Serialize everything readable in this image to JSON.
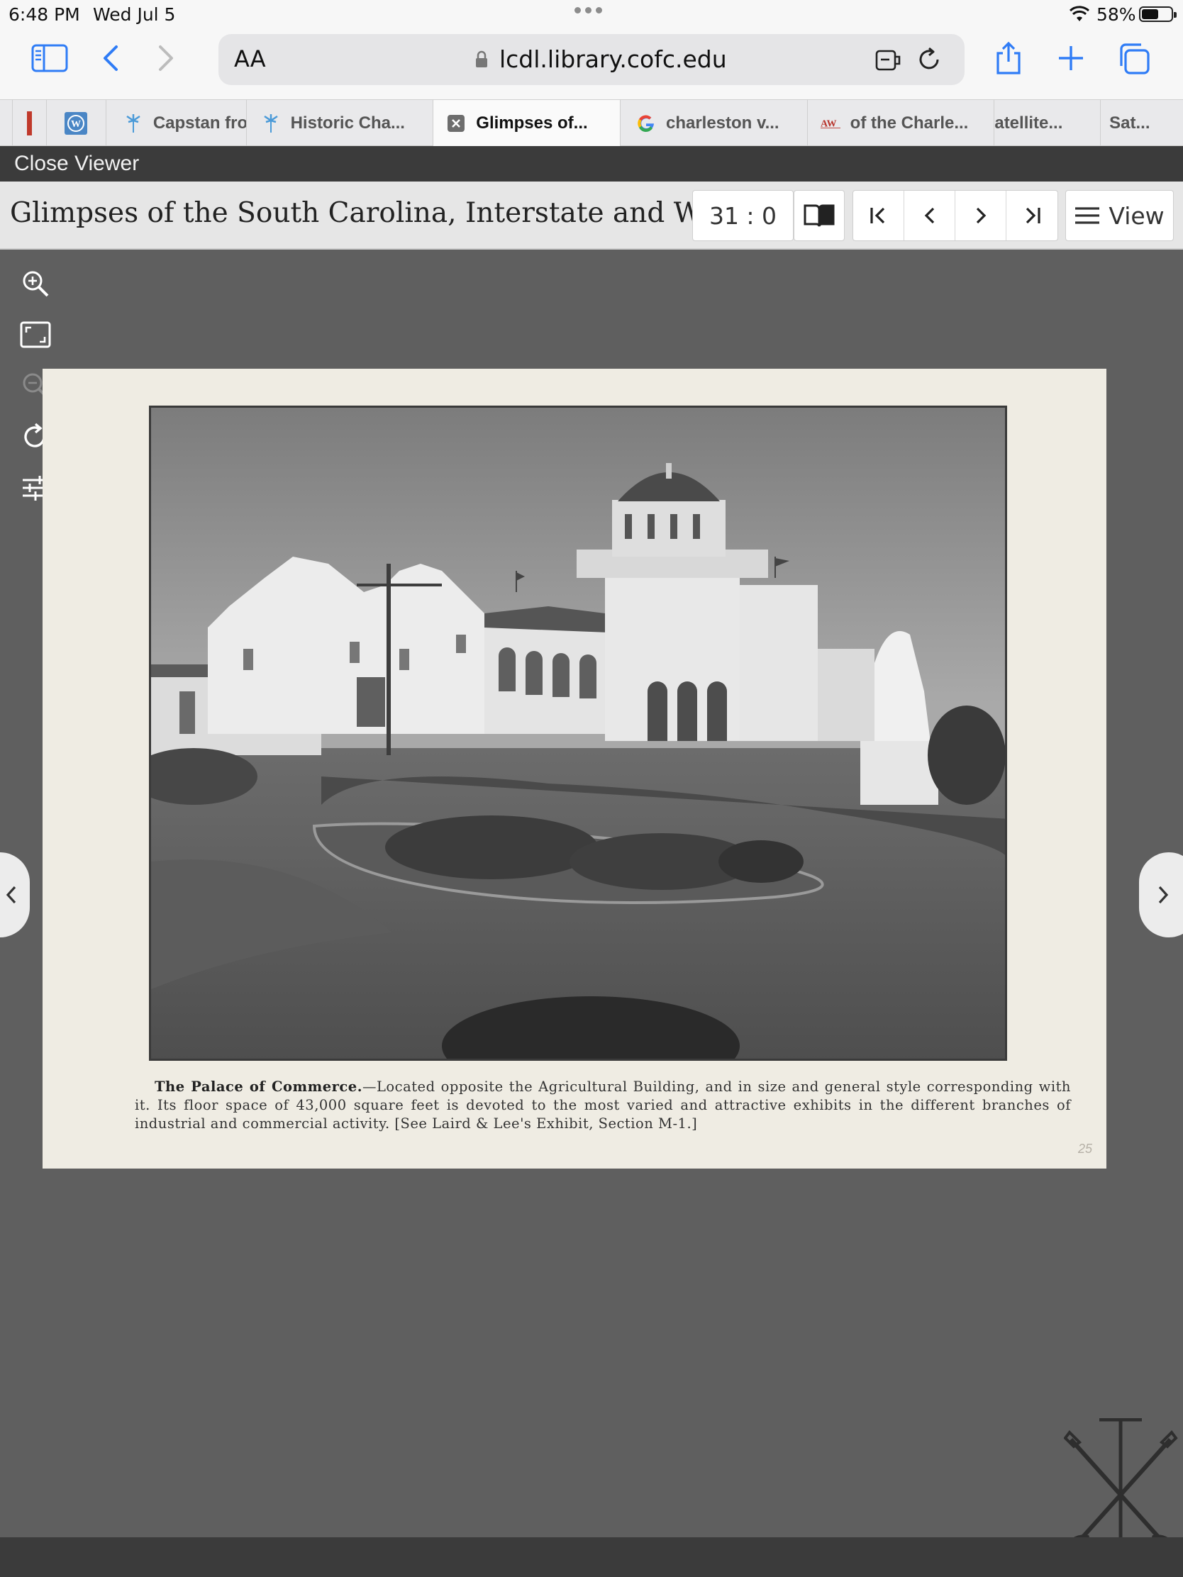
{
  "status_bar": {
    "time": "6:48 PM",
    "date": "Wed Jul 5",
    "battery_percent": "58%",
    "battery_level": 0.58
  },
  "toolbar": {
    "text_size_label": "AA",
    "url": "lcdl.library.cofc.edu"
  },
  "tabs": [
    {
      "label": "",
      "icon": "bookmark-red-icon",
      "active": false
    },
    {
      "label": "",
      "icon": "wordpress-icon",
      "active": false
    },
    {
      "label": "Capstan fro",
      "icon": "palmetto-icon",
      "active": false
    },
    {
      "label": "Historic Cha...",
      "icon": "palmetto-icon",
      "active": false
    },
    {
      "label": "Glimpses of...",
      "icon": "close-tab-icon",
      "active": true
    },
    {
      "label": "charleston v...",
      "icon": "google-icon",
      "active": false
    },
    {
      "label": "of the Charle...",
      "icon": "aw-icon",
      "active": false
    },
    {
      "label": "atellite...",
      "icon": "",
      "active": false
    },
    {
      "label": "Sat...",
      "icon": "",
      "active": false
    }
  ],
  "close_viewer": {
    "label": "Close Viewer"
  },
  "viewer_header": {
    "title": "Glimpses of the South Carolina, Interstate and Wes...",
    "page_number": "31 : 0",
    "view_label": "View"
  },
  "document": {
    "caption_title": "The Palace of Commerce.",
    "caption_body": "—Located opposite the Agricultural Building, and in size and general style corresponding with it. Its floor space of 43,000 square feet is devoted to the most varied and attractive exhibits in the different branches of industrial and commercial activity. [See Laird & Lee's Exhibit, Section M-1.]",
    "page_mark": "25"
  },
  "colors": {
    "accent": "#2f7cf6",
    "viewer_bg": "#5f5f5f",
    "dark_bar": "#3b3b3b",
    "paper": "#efece3"
  }
}
